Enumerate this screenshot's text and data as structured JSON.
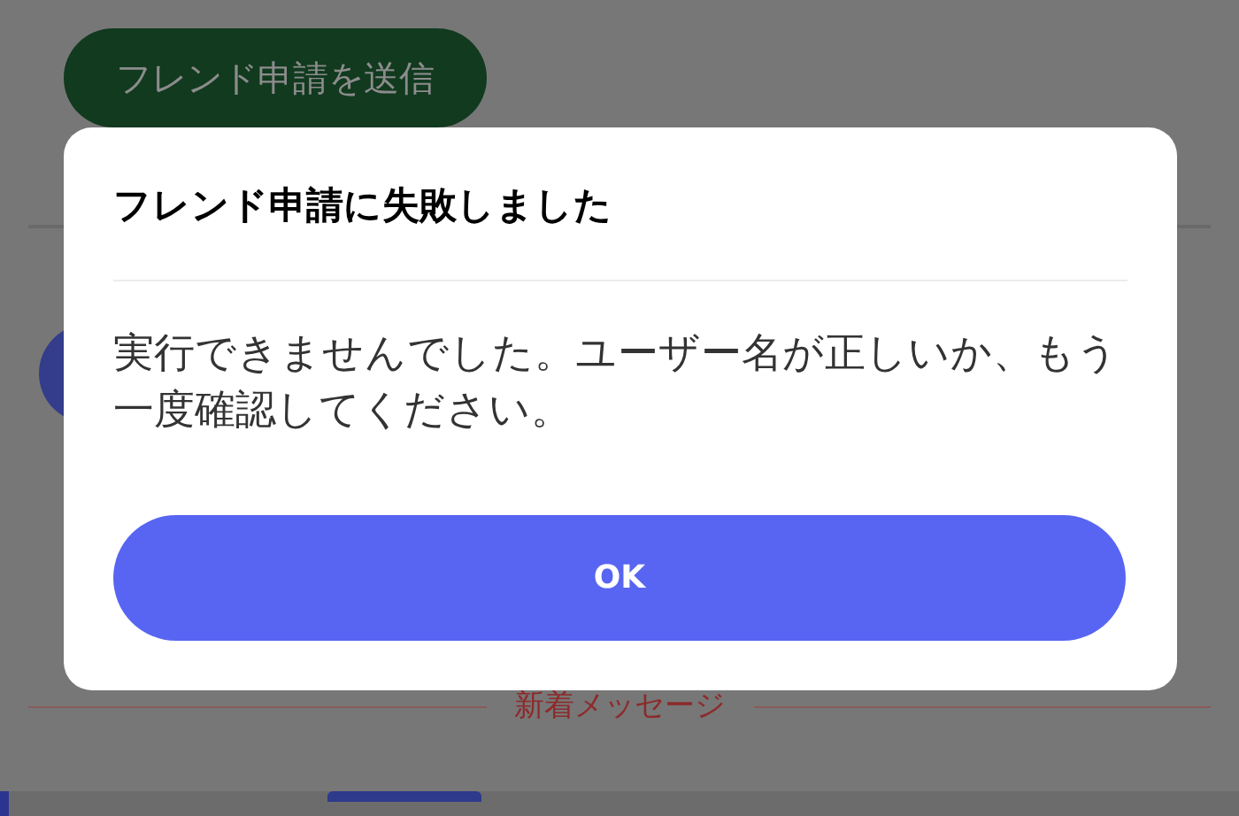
{
  "background": {
    "send_button": "フレンド申請を送信",
    "divider_label": "新着メッセージ"
  },
  "dialog": {
    "title": "フレンド申請に失敗しました",
    "message": "実行できませんでした。ユーザー名が正しいか、もう一度確認してください。",
    "buttons": [
      {
        "label": "OK",
        "kind": "primary"
      }
    ]
  }
}
